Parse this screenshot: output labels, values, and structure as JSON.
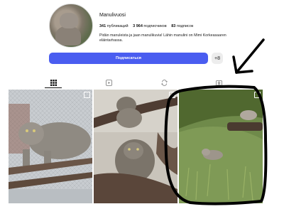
{
  "profile": {
    "username": "Manulivuosi",
    "stats": [
      {
        "count": "341",
        "label": "публикаций"
      },
      {
        "count": "3 964",
        "label": "подписчиков"
      },
      {
        "count": "83",
        "label": "подписок"
      }
    ],
    "bio": "Pidän manuleista ja jaan manulikuvia! Lähin manulini on Mimi Korkeasaaren eläintarhassa."
  },
  "actions": {
    "follow_label": "Подписаться",
    "add_user_glyph": "+8"
  },
  "tabs": [
    {
      "name": "grid-icon",
      "active": true
    },
    {
      "name": "reels-icon",
      "active": false
    },
    {
      "name": "reposts-icon",
      "active": false
    },
    {
      "name": "tagged-icon",
      "active": false
    }
  ],
  "posts": [
    {
      "name": "post-manul-on-branch",
      "type": "carousel"
    },
    {
      "name": "post-manul-kittens",
      "type": "carousel"
    },
    {
      "name": "post-manul-in-grass",
      "type": "video"
    }
  ],
  "annotation": {
    "color": "#000000"
  }
}
